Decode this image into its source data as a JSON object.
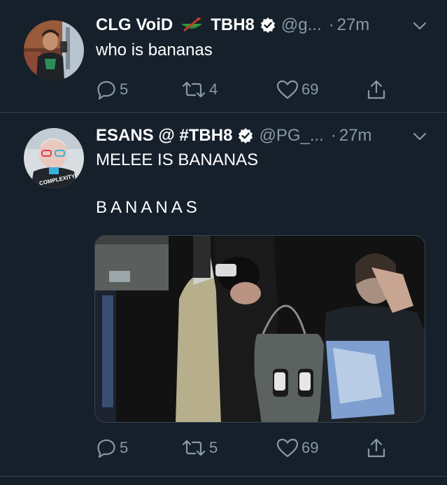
{
  "colors": {
    "background": "#15202b",
    "text_primary": "#ffffff",
    "text_secondary": "#8899a6",
    "divider": "#38444d"
  },
  "tweets": [
    {
      "display_name": "CLG VoiD",
      "name_extra": "TBH8",
      "name_emoji": "green-canoe-paddle-emoji",
      "verified": true,
      "handle": "@g...",
      "dot": "·",
      "time": "27m",
      "text": "who is bananas",
      "actions": {
        "reply": "5",
        "retweet": "4",
        "like": "69"
      },
      "icons": [
        "reply-icon",
        "retweet-icon",
        "like-icon",
        "share-icon",
        "chevron-down-icon",
        "verified-badge-icon"
      ]
    },
    {
      "display_name": "ESANS @ #TBH8",
      "verified": true,
      "handle": "@PG_...",
      "dot": "·",
      "time": "27m",
      "text_line1": "MELEE IS BANANAS",
      "text_line2": "BANANAS",
      "has_media": true,
      "actions": {
        "reply": "5",
        "retweet": "5",
        "like": "69"
      },
      "icons": [
        "reply-icon",
        "retweet-icon",
        "like-icon",
        "share-icon",
        "chevron-down-icon",
        "verified-badge-icon"
      ]
    }
  ]
}
